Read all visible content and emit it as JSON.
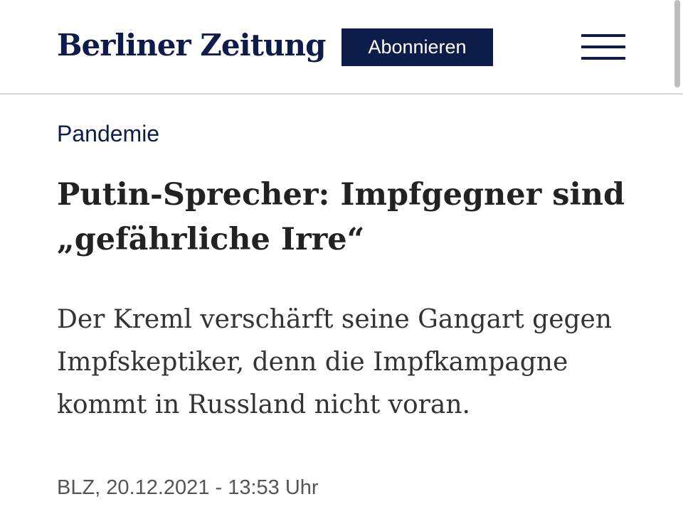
{
  "header": {
    "logo": "Berliner Zeitung",
    "subscribe_label": "Abonnieren",
    "menu_icon": "hamburger-menu-icon"
  },
  "article": {
    "category": "Pandemie",
    "headline": "Putin-Sprecher: Impfgegner sind „gefährliche Irre“",
    "lead": "Der Kreml verschärft seine Gangart gegen Impfskeptiker, denn die Impfkampagne kommt in Russland nicht voran.",
    "meta": "BLZ, 20.12.2021 - 13:53 Uhr"
  },
  "colors": {
    "brand_navy": "#0e1c4a",
    "text_dark": "#222222",
    "text_meta": "#555555",
    "divider": "#d6d6d6"
  }
}
